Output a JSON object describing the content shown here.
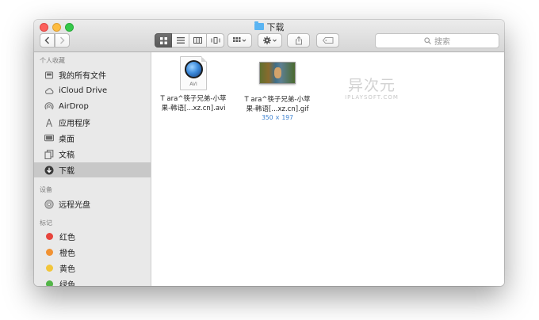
{
  "window": {
    "title": "下载"
  },
  "toolbar": {
    "back_icon": "chevron-left-icon",
    "forward_icon": "chevron-right-icon",
    "views": [
      "icon-view-icon",
      "list-view-icon",
      "column-view-icon",
      "cover-flow-icon"
    ],
    "active_view": 0,
    "search_placeholder": "搜索"
  },
  "sidebar": {
    "favorites_header": "个人收藏",
    "favorites": [
      {
        "label": "我的所有文件",
        "icon": "all-files-icon"
      },
      {
        "label": "iCloud Drive",
        "icon": "cloud-icon"
      },
      {
        "label": "AirDrop",
        "icon": "airdrop-icon"
      },
      {
        "label": "应用程序",
        "icon": "applications-icon"
      },
      {
        "label": "桌面",
        "icon": "desktop-icon"
      },
      {
        "label": "文稿",
        "icon": "documents-icon"
      },
      {
        "label": "下载",
        "icon": "downloads-icon",
        "selected": true
      }
    ],
    "devices_header": "设备",
    "devices": [
      {
        "label": "远程光盘",
        "icon": "disc-icon"
      }
    ],
    "tags_header": "标记",
    "tags": [
      {
        "label": "红色",
        "color": "#e7453d"
      },
      {
        "label": "橙色",
        "color": "#f19233"
      },
      {
        "label": "黄色",
        "color": "#f2c53a"
      },
      {
        "label": "绿色",
        "color": "#53b548"
      }
    ]
  },
  "files": [
    {
      "name": "T ara^筷子兄弟-小苹\n果-韩语[...xz.cn].avi",
      "kind_label": "AVI",
      "icon": "quicktime-avi-icon"
    },
    {
      "name": "T ara^筷子兄弟-小苹\n果-韩语[...xz.cn].gif",
      "dimensions": "350 × 197",
      "icon": "gif-thumbnail"
    }
  ],
  "watermark": {
    "main": "异次元",
    "sub": "IPLAYSOFT.COM"
  }
}
